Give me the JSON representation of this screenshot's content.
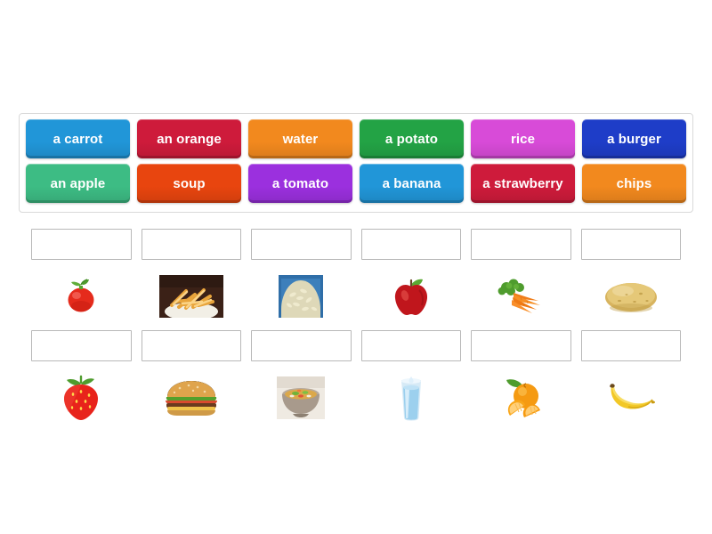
{
  "activity": {
    "type": "match-up",
    "word_bank": {
      "rows": [
        [
          {
            "label": "a carrot",
            "color": "#2196d8"
          },
          {
            "label": "an orange",
            "color": "#ce1b3b"
          },
          {
            "label": "water",
            "color": "#f2891e"
          },
          {
            "label": "a potato",
            "color": "#23a345"
          },
          {
            "label": "rice",
            "color": "#d84bd8"
          },
          {
            "label": "a burger",
            "color": "#1e3dc8"
          }
        ],
        [
          {
            "label": "an apple",
            "color": "#3dbc84"
          },
          {
            "label": "soup",
            "color": "#e8450f"
          },
          {
            "label": "a tomato",
            "color": "#9b30de"
          },
          {
            "label": "a banana",
            "color": "#2196d8"
          },
          {
            "label": "a strawberry",
            "color": "#ce1b3b"
          },
          {
            "label": "chips",
            "color": "#f2891e"
          }
        ]
      ]
    },
    "answer_rows": [
      {
        "items": [
          {
            "dropzone_value": "",
            "image_name": "tomato-image",
            "image_alt": "tomato"
          },
          {
            "dropzone_value": "",
            "image_name": "chips-image",
            "image_alt": "chips"
          },
          {
            "dropzone_value": "",
            "image_name": "rice-image",
            "image_alt": "rice"
          },
          {
            "dropzone_value": "",
            "image_name": "apple-image",
            "image_alt": "apple"
          },
          {
            "dropzone_value": "",
            "image_name": "carrots-image",
            "image_alt": "carrots"
          },
          {
            "dropzone_value": "",
            "image_name": "potato-image",
            "image_alt": "potato"
          }
        ]
      },
      {
        "items": [
          {
            "dropzone_value": "",
            "image_name": "strawberry-image",
            "image_alt": "strawberry"
          },
          {
            "dropzone_value": "",
            "image_name": "burger-image",
            "image_alt": "burger"
          },
          {
            "dropzone_value": "",
            "image_name": "soup-image",
            "image_alt": "soup"
          },
          {
            "dropzone_value": "",
            "image_name": "water-image",
            "image_alt": "glass of water"
          },
          {
            "dropzone_value": "",
            "image_name": "orange-image",
            "image_alt": "orange"
          },
          {
            "dropzone_value": "",
            "image_name": "banana-image",
            "image_alt": "banana"
          }
        ]
      }
    ]
  }
}
